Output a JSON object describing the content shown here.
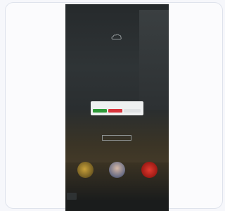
{
  "nav": {
    "items": [
      "",
      "",
      "",
      "",
      "",
      ""
    ]
  },
  "brand": {
    "name": "",
    "tagline": ""
  },
  "side_text": "",
  "cta": {
    "label": ""
  },
  "section_label": "",
  "dialog": {
    "accept_label": "",
    "reject_label": "",
    "more_label": ""
  },
  "colors": {
    "accept": "#2f9a39",
    "reject": "#d8353c",
    "overlay_bg": "#1d2122"
  }
}
